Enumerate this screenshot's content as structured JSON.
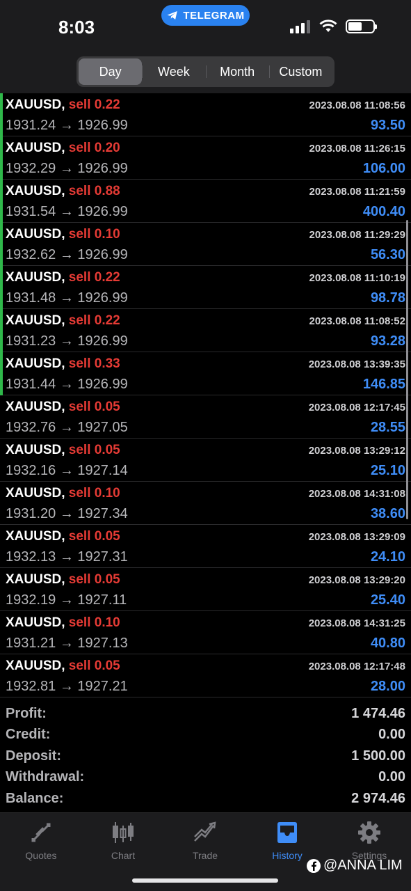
{
  "status_bar": {
    "time": "8:03",
    "telegram_label": "TELEGRAM",
    "icons": [
      "signal-icon",
      "wifi-icon",
      "battery-icon"
    ]
  },
  "period_tabs": {
    "items": [
      "Day",
      "Week",
      "Month",
      "Custom"
    ],
    "selected": "Day"
  },
  "trades": [
    {
      "symbol": "XAUUSD,",
      "side": "sell 0.22",
      "prices": "1931.24 → 1926.99",
      "time": "2023.08.08 11:08:56",
      "profit": "93.50"
    },
    {
      "symbol": "XAUUSD,",
      "side": "sell 0.20",
      "prices": "1932.29 → 1926.99",
      "time": "2023.08.08 11:26:15",
      "profit": "106.00"
    },
    {
      "symbol": "XAUUSD,",
      "side": "sell 0.88",
      "prices": "1931.54 → 1926.99",
      "time": "2023.08.08 11:21:59",
      "profit": "400.40"
    },
    {
      "symbol": "XAUUSD,",
      "side": "sell 0.10",
      "prices": "1932.62 → 1926.99",
      "time": "2023.08.08 11:29:29",
      "profit": "56.30"
    },
    {
      "symbol": "XAUUSD,",
      "side": "sell 0.22",
      "prices": "1931.48 → 1926.99",
      "time": "2023.08.08 11:10:19",
      "profit": "98.78"
    },
    {
      "symbol": "XAUUSD,",
      "side": "sell 0.22",
      "prices": "1931.23 → 1926.99",
      "time": "2023.08.08 11:08:52",
      "profit": "93.28"
    },
    {
      "symbol": "XAUUSD,",
      "side": "sell 0.33",
      "prices": "1931.44 → 1926.99",
      "time": "2023.08.08 13:39:35",
      "profit": "146.85"
    },
    {
      "symbol": "XAUUSD,",
      "side": "sell 0.05",
      "prices": "1932.76 → 1927.05",
      "time": "2023.08.08 12:17:45",
      "profit": "28.55"
    },
    {
      "symbol": "XAUUSD,",
      "side": "sell 0.05",
      "prices": "1932.16 → 1927.14",
      "time": "2023.08.08 13:29:12",
      "profit": "25.10"
    },
    {
      "symbol": "XAUUSD,",
      "side": "sell 0.10",
      "prices": "1931.20 → 1927.34",
      "time": "2023.08.08 14:31:08",
      "profit": "38.60"
    },
    {
      "symbol": "XAUUSD,",
      "side": "sell 0.05",
      "prices": "1932.13 → 1927.31",
      "time": "2023.08.08 13:29:09",
      "profit": "24.10"
    },
    {
      "symbol": "XAUUSD,",
      "side": "sell 0.05",
      "prices": "1932.19 → 1927.11",
      "time": "2023.08.08 13:29:20",
      "profit": "25.40"
    },
    {
      "symbol": "XAUUSD,",
      "side": "sell 0.10",
      "prices": "1931.21 → 1927.13",
      "time": "2023.08.08 14:31:25",
      "profit": "40.80"
    },
    {
      "symbol": "XAUUSD,",
      "side": "sell 0.05",
      "prices": "1932.81 → 1927.21",
      "time": "2023.08.08 12:17:48",
      "profit": "28.00"
    }
  ],
  "highlighted_rows": 7,
  "summary": [
    {
      "label": "Profit:",
      "value": "1 474.46"
    },
    {
      "label": "Credit:",
      "value": "0.00"
    },
    {
      "label": "Deposit:",
      "value": "1 500.00"
    },
    {
      "label": "Withdrawal:",
      "value": "0.00"
    },
    {
      "label": "Balance:",
      "value": "2 974.46"
    }
  ],
  "tabbar": {
    "items": [
      {
        "label": "Quotes",
        "icon": "quotes-icon"
      },
      {
        "label": "Chart",
        "icon": "candlestick-icon"
      },
      {
        "label": "Trade",
        "icon": "trade-icon"
      },
      {
        "label": "History",
        "icon": "history-inbox-icon"
      },
      {
        "label": "Settings",
        "icon": "gear-icon"
      }
    ],
    "selected": "History"
  },
  "watermark": "@ANNA LIM",
  "colors": {
    "sell": "#e63b35",
    "profit": "#3f8df7",
    "accent": "#3f8df7",
    "highlight_bar": "#2fb84a",
    "telegram": "#2a82f0"
  }
}
